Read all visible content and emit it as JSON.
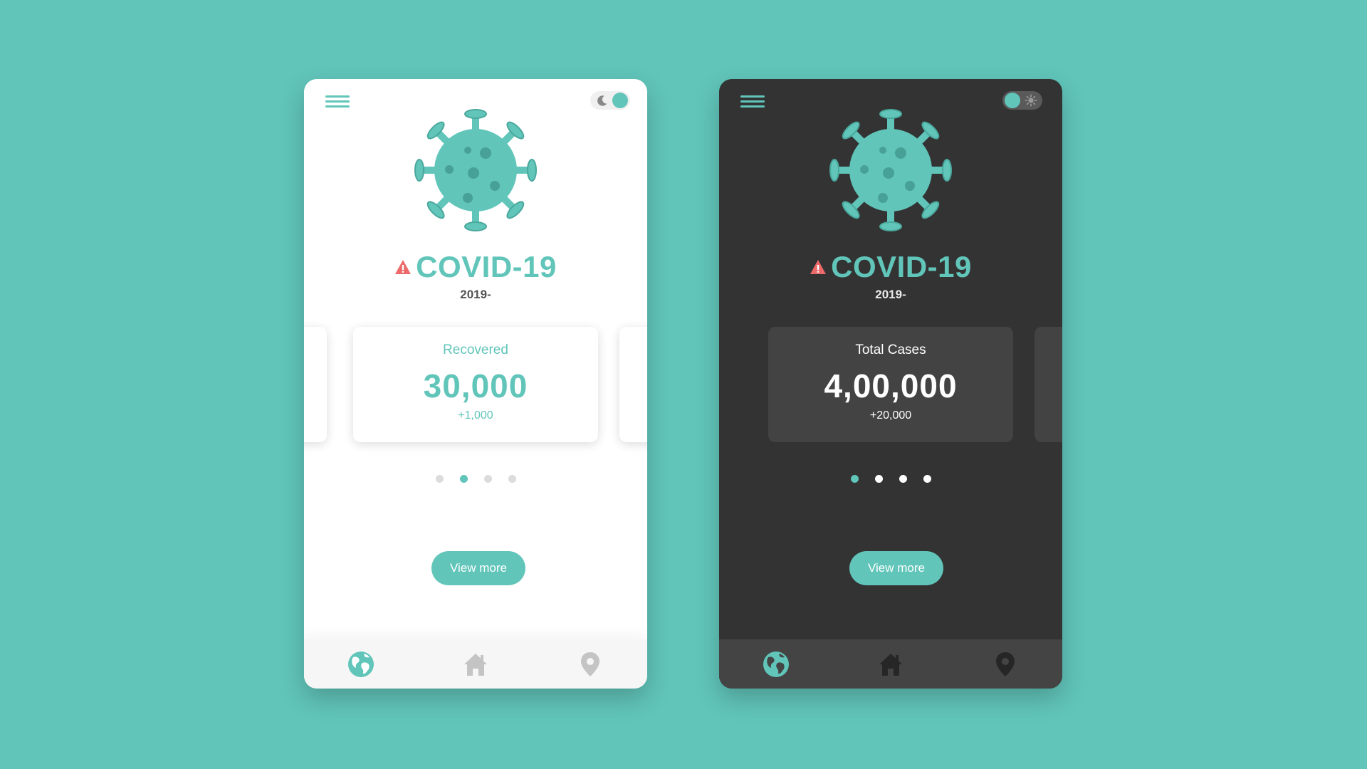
{
  "colors": {
    "background": "#61c5ba",
    "accent": "#61c5ba",
    "warning": "#ee6a6a",
    "dark_panel": "#333333",
    "dark_card": "#434343"
  },
  "light": {
    "title": "COVID-19",
    "subtitle": "2019-",
    "card": {
      "label": "Recovered",
      "value": "30,000",
      "delta": "+1,000"
    },
    "dots_active": 1,
    "view_more": "View more",
    "nav": [
      "globe-icon",
      "home-icon",
      "location-pin-icon"
    ]
  },
  "dark": {
    "title": "COVID-19",
    "subtitle": "2019-",
    "card": {
      "label": "Total Cases",
      "value": "4,00,000",
      "delta": "+20,000"
    },
    "dots_active": 0,
    "view_more": "View more",
    "nav": [
      "globe-icon",
      "home-icon",
      "location-pin-icon"
    ]
  }
}
